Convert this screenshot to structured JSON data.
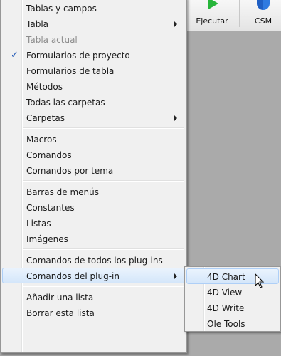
{
  "toolbar": {
    "run_label": "Ejecutar",
    "csm_label": "CSM"
  },
  "menu": {
    "items": [
      {
        "label": "Tablas y campos"
      },
      {
        "label": "Tabla"
      },
      {
        "label": "Tabla actual"
      },
      {
        "label": "Formularios de proyecto",
        "checkmark": "✓"
      },
      {
        "label": "Formularios de tabla"
      },
      {
        "label": "Métodos"
      },
      {
        "label": "Todas las carpetas"
      },
      {
        "label": "Carpetas"
      },
      {
        "label": "Macros"
      },
      {
        "label": "Comandos"
      },
      {
        "label": "Comandos por tema"
      },
      {
        "label": "Barras de menús"
      },
      {
        "label": "Constantes"
      },
      {
        "label": "Listas"
      },
      {
        "label": "Imágenes"
      },
      {
        "label": "Comandos de todos los plug-ins"
      },
      {
        "label": "Comandos del plug-in"
      },
      {
        "label": "Añadir una lista"
      },
      {
        "label": "Borrar esta lista"
      }
    ]
  },
  "submenu": {
    "items": [
      {
        "label": "4D Chart"
      },
      {
        "label": "4D View"
      },
      {
        "label": "4D Write"
      },
      {
        "label": "Ole Tools"
      }
    ]
  },
  "colors": {
    "menu_bg": "#f0f0f0",
    "hover_border": "#aecff7",
    "check": "#1b55b5",
    "run_icon": "#27b53a",
    "csm_icon": "#1f5fc4"
  },
  "icons": {
    "run": "play-icon",
    "csm": "shield-icon",
    "checked": "checkmark-icon",
    "submenu": "chevron-right-icon",
    "cursor": "mouse-pointer-icon"
  }
}
